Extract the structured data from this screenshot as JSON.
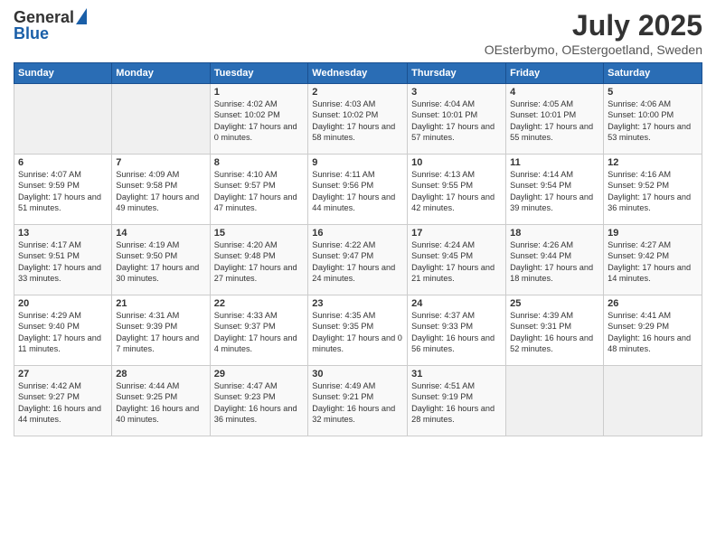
{
  "header": {
    "logo_general": "General",
    "logo_blue": "Blue",
    "month": "July 2025",
    "location": "OEsterbymo, OEstergoetland, Sweden"
  },
  "weekdays": [
    "Sunday",
    "Monday",
    "Tuesday",
    "Wednesday",
    "Thursday",
    "Friday",
    "Saturday"
  ],
  "weeks": [
    [
      {
        "day": "",
        "sunrise": "",
        "sunset": "",
        "daylight": ""
      },
      {
        "day": "",
        "sunrise": "",
        "sunset": "",
        "daylight": ""
      },
      {
        "day": "1",
        "sunrise": "Sunrise: 4:02 AM",
        "sunset": "Sunset: 10:02 PM",
        "daylight": "Daylight: 17 hours and 0 minutes."
      },
      {
        "day": "2",
        "sunrise": "Sunrise: 4:03 AM",
        "sunset": "Sunset: 10:02 PM",
        "daylight": "Daylight: 17 hours and 58 minutes."
      },
      {
        "day": "3",
        "sunrise": "Sunrise: 4:04 AM",
        "sunset": "Sunset: 10:01 PM",
        "daylight": "Daylight: 17 hours and 57 minutes."
      },
      {
        "day": "4",
        "sunrise": "Sunrise: 4:05 AM",
        "sunset": "Sunset: 10:01 PM",
        "daylight": "Daylight: 17 hours and 55 minutes."
      },
      {
        "day": "5",
        "sunrise": "Sunrise: 4:06 AM",
        "sunset": "Sunset: 10:00 PM",
        "daylight": "Daylight: 17 hours and 53 minutes."
      }
    ],
    [
      {
        "day": "6",
        "sunrise": "Sunrise: 4:07 AM",
        "sunset": "Sunset: 9:59 PM",
        "daylight": "Daylight: 17 hours and 51 minutes."
      },
      {
        "day": "7",
        "sunrise": "Sunrise: 4:09 AM",
        "sunset": "Sunset: 9:58 PM",
        "daylight": "Daylight: 17 hours and 49 minutes."
      },
      {
        "day": "8",
        "sunrise": "Sunrise: 4:10 AM",
        "sunset": "Sunset: 9:57 PM",
        "daylight": "Daylight: 17 hours and 47 minutes."
      },
      {
        "day": "9",
        "sunrise": "Sunrise: 4:11 AM",
        "sunset": "Sunset: 9:56 PM",
        "daylight": "Daylight: 17 hours and 44 minutes."
      },
      {
        "day": "10",
        "sunrise": "Sunrise: 4:13 AM",
        "sunset": "Sunset: 9:55 PM",
        "daylight": "Daylight: 17 hours and 42 minutes."
      },
      {
        "day": "11",
        "sunrise": "Sunrise: 4:14 AM",
        "sunset": "Sunset: 9:54 PM",
        "daylight": "Daylight: 17 hours and 39 minutes."
      },
      {
        "day": "12",
        "sunrise": "Sunrise: 4:16 AM",
        "sunset": "Sunset: 9:52 PM",
        "daylight": "Daylight: 17 hours and 36 minutes."
      }
    ],
    [
      {
        "day": "13",
        "sunrise": "Sunrise: 4:17 AM",
        "sunset": "Sunset: 9:51 PM",
        "daylight": "Daylight: 17 hours and 33 minutes."
      },
      {
        "day": "14",
        "sunrise": "Sunrise: 4:19 AM",
        "sunset": "Sunset: 9:50 PM",
        "daylight": "Daylight: 17 hours and 30 minutes."
      },
      {
        "day": "15",
        "sunrise": "Sunrise: 4:20 AM",
        "sunset": "Sunset: 9:48 PM",
        "daylight": "Daylight: 17 hours and 27 minutes."
      },
      {
        "day": "16",
        "sunrise": "Sunrise: 4:22 AM",
        "sunset": "Sunset: 9:47 PM",
        "daylight": "Daylight: 17 hours and 24 minutes."
      },
      {
        "day": "17",
        "sunrise": "Sunrise: 4:24 AM",
        "sunset": "Sunset: 9:45 PM",
        "daylight": "Daylight: 17 hours and 21 minutes."
      },
      {
        "day": "18",
        "sunrise": "Sunrise: 4:26 AM",
        "sunset": "Sunset: 9:44 PM",
        "daylight": "Daylight: 17 hours and 18 minutes."
      },
      {
        "day": "19",
        "sunrise": "Sunrise: 4:27 AM",
        "sunset": "Sunset: 9:42 PM",
        "daylight": "Daylight: 17 hours and 14 minutes."
      }
    ],
    [
      {
        "day": "20",
        "sunrise": "Sunrise: 4:29 AM",
        "sunset": "Sunset: 9:40 PM",
        "daylight": "Daylight: 17 hours and 11 minutes."
      },
      {
        "day": "21",
        "sunrise": "Sunrise: 4:31 AM",
        "sunset": "Sunset: 9:39 PM",
        "daylight": "Daylight: 17 hours and 7 minutes."
      },
      {
        "day": "22",
        "sunrise": "Sunrise: 4:33 AM",
        "sunset": "Sunset: 9:37 PM",
        "daylight": "Daylight: 17 hours and 4 minutes."
      },
      {
        "day": "23",
        "sunrise": "Sunrise: 4:35 AM",
        "sunset": "Sunset: 9:35 PM",
        "daylight": "Daylight: 17 hours and 0 minutes."
      },
      {
        "day": "24",
        "sunrise": "Sunrise: 4:37 AM",
        "sunset": "Sunset: 9:33 PM",
        "daylight": "Daylight: 16 hours and 56 minutes."
      },
      {
        "day": "25",
        "sunrise": "Sunrise: 4:39 AM",
        "sunset": "Sunset: 9:31 PM",
        "daylight": "Daylight: 16 hours and 52 minutes."
      },
      {
        "day": "26",
        "sunrise": "Sunrise: 4:41 AM",
        "sunset": "Sunset: 9:29 PM",
        "daylight": "Daylight: 16 hours and 48 minutes."
      }
    ],
    [
      {
        "day": "27",
        "sunrise": "Sunrise: 4:42 AM",
        "sunset": "Sunset: 9:27 PM",
        "daylight": "Daylight: 16 hours and 44 minutes."
      },
      {
        "day": "28",
        "sunrise": "Sunrise: 4:44 AM",
        "sunset": "Sunset: 9:25 PM",
        "daylight": "Daylight: 16 hours and 40 minutes."
      },
      {
        "day": "29",
        "sunrise": "Sunrise: 4:47 AM",
        "sunset": "Sunset: 9:23 PM",
        "daylight": "Daylight: 16 hours and 36 minutes."
      },
      {
        "day": "30",
        "sunrise": "Sunrise: 4:49 AM",
        "sunset": "Sunset: 9:21 PM",
        "daylight": "Daylight: 16 hours and 32 minutes."
      },
      {
        "day": "31",
        "sunrise": "Sunrise: 4:51 AM",
        "sunset": "Sunset: 9:19 PM",
        "daylight": "Daylight: 16 hours and 28 minutes."
      },
      {
        "day": "",
        "sunrise": "",
        "sunset": "",
        "daylight": ""
      },
      {
        "day": "",
        "sunrise": "",
        "sunset": "",
        "daylight": ""
      }
    ]
  ]
}
